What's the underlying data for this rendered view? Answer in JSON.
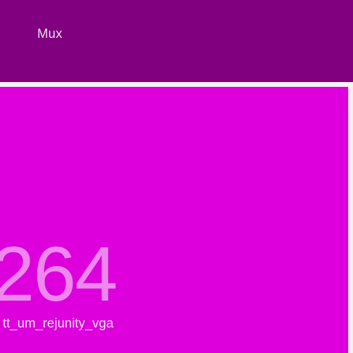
{
  "header": {
    "title": "Mux"
  },
  "tile": {
    "value": "264",
    "label": "tt_um_rejunity_vga"
  },
  "colors": {
    "header_bg": "#800080",
    "tile_bg": "#dd00dd",
    "value_text": "#ee88ee",
    "label_text": "#f6ddf6"
  }
}
